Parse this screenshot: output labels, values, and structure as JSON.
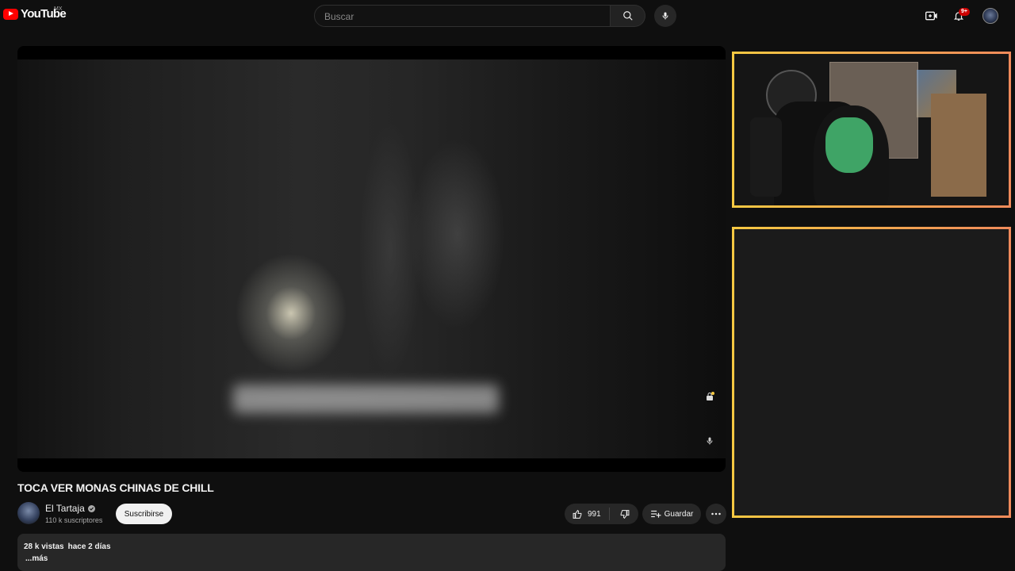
{
  "header": {
    "logo_text": "YouTube",
    "country_code": "MX",
    "search_placeholder": "Buscar",
    "notification_count": "9+"
  },
  "video": {
    "title": "TOCA VER MONAS CHINAS DE CHILL",
    "channel_name": "El Tartaja",
    "subscribers": "110 k suscriptores",
    "subscribe_label": "Suscribirse",
    "likes": "991",
    "save_label": "Guardar",
    "views": "28 k vistas",
    "date": "hace 2 días",
    "more_label": "...más"
  },
  "icons": {
    "search": "search-icon",
    "mic": "microphone-icon",
    "create": "create-video-icon",
    "bell": "bell-icon",
    "like": "thumbs-up-icon",
    "dislike": "thumbs-down-icon",
    "save": "playlist-add-icon",
    "more": "more-horizontal-icon"
  },
  "colors": {
    "background": "#0f0f0f",
    "brand_red": "#ff0000",
    "overlay_border_start": "#f5c842",
    "overlay_border_end": "#f08a5a",
    "button_bg": "#272727"
  }
}
